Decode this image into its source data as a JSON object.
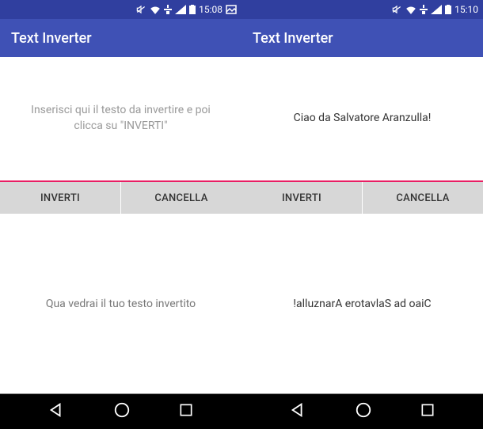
{
  "left": {
    "status": {
      "time": "15:08"
    },
    "appbar": {
      "title": "Text Inverter"
    },
    "input": {
      "placeholder": "Inserisci qui il testo da invertire e poi clicca su \"INVERTI\"",
      "value": ""
    },
    "buttons": {
      "invert": "INVERTI",
      "clear": "CANCELLA"
    },
    "output": {
      "placeholder": "Qua vedrai il tuo testo invertito",
      "value": ""
    }
  },
  "right": {
    "status": {
      "time": "15:10"
    },
    "appbar": {
      "title": "Text Inverter"
    },
    "input": {
      "placeholder": "",
      "value": "Ciao da Salvatore Aranzulla!"
    },
    "buttons": {
      "invert": "INVERTI",
      "clear": "CANCELLA"
    },
    "output": {
      "placeholder": "",
      "value": "!alluznarA erotavlaS ad oaiC"
    }
  }
}
